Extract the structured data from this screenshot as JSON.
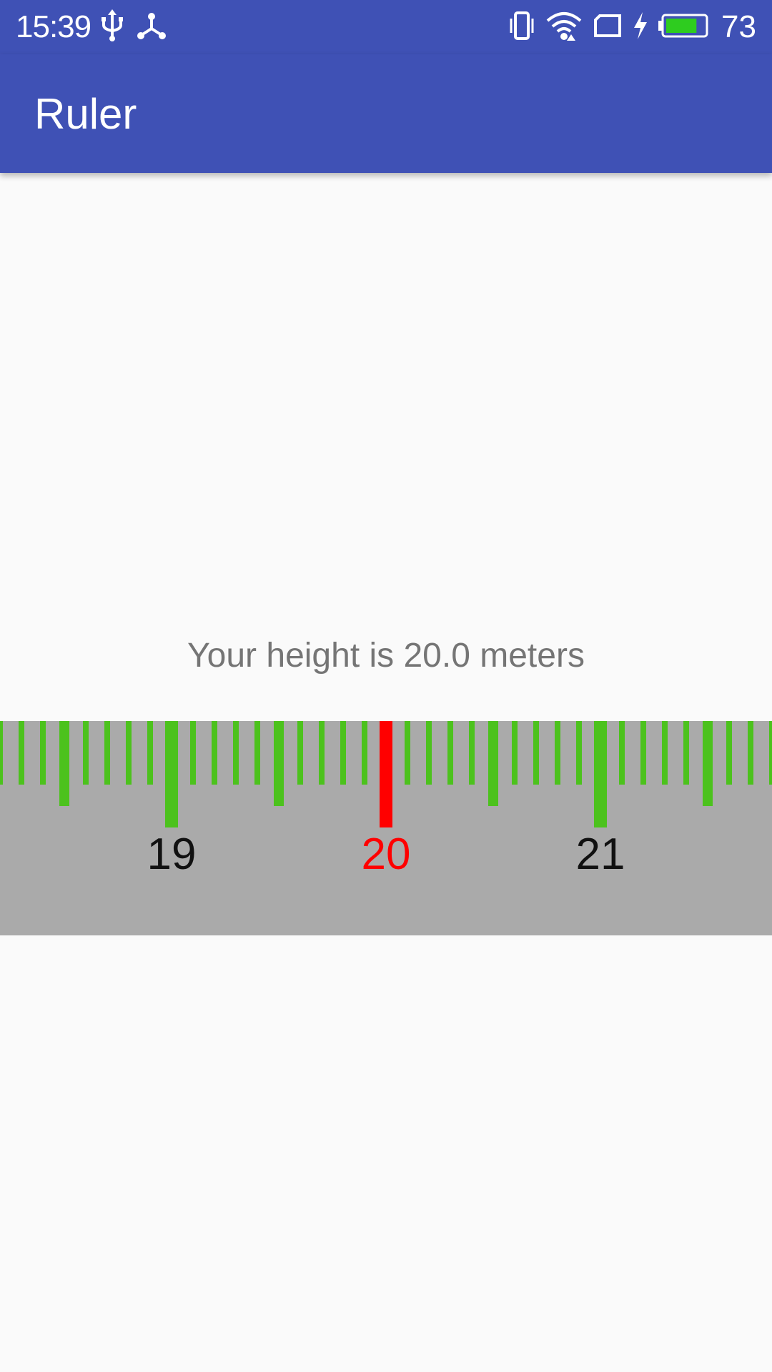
{
  "status_bar": {
    "time": "15:39",
    "battery_percent": "73",
    "battery_level": 0.73,
    "icons": [
      "usb-icon",
      "network-icon",
      "vibrate-icon",
      "wifi-icon",
      "no-sim-icon",
      "charging-icon",
      "battery-icon"
    ]
  },
  "app_bar": {
    "title": "Ruler"
  },
  "main": {
    "height_text": "Your height is 20.0 meters"
  },
  "ruler": {
    "selected_value": 20.0,
    "labels": [
      "19",
      "20",
      "21"
    ],
    "colors": {
      "background": "#AAAAAA",
      "tick": "#4CC21D",
      "selected": "#FF0000"
    }
  },
  "colors": {
    "primary": "#3F51B5",
    "background": "#FAFAFA",
    "label_text": "#757575"
  }
}
